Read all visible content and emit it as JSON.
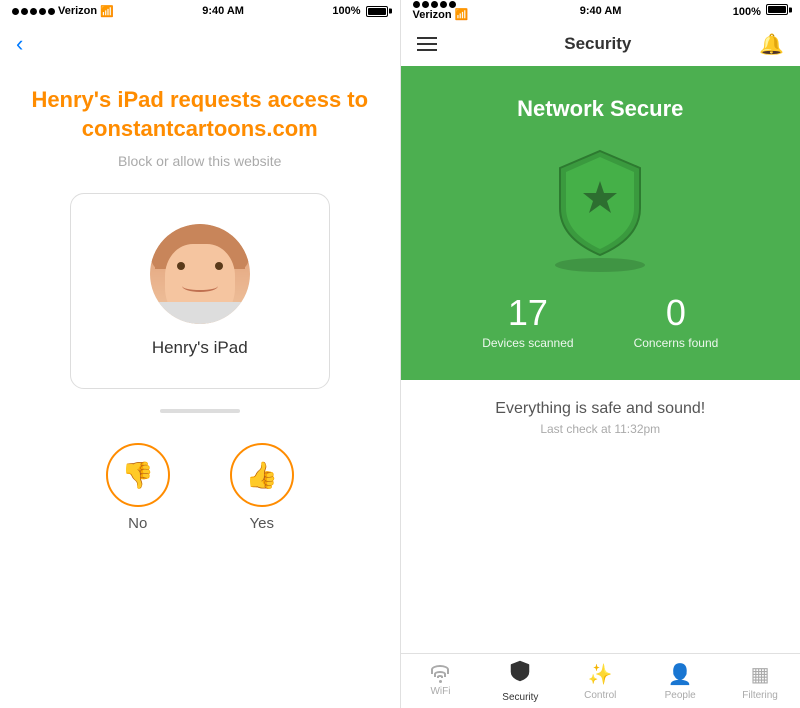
{
  "left": {
    "status_bar": {
      "carrier": "Verizon",
      "time": "9:40 AM",
      "battery": "100%"
    },
    "request_title": "Henry's iPad requests access to constantcartoons.com",
    "request_subtitle": "Block or allow this website",
    "device_name": "Henry's iPad",
    "no_label": "No",
    "yes_label": "Yes"
  },
  "right": {
    "status_bar": {
      "carrier": "Verizon",
      "time": "9:40 AM",
      "battery": "100%"
    },
    "title": "Security",
    "banner": {
      "heading": "Network Secure",
      "devices_scanned_count": "17",
      "devices_scanned_label": "Devices scanned",
      "concerns_found_count": "0",
      "concerns_found_label": "Concerns found"
    },
    "safe_text": "Everything is safe and sound!",
    "last_check": "Last check at 11:32pm",
    "tabs": [
      {
        "id": "wifi",
        "label": "WiFi"
      },
      {
        "id": "security",
        "label": "Security"
      },
      {
        "id": "control",
        "label": "Control"
      },
      {
        "id": "people",
        "label": "People"
      },
      {
        "id": "filtering",
        "label": "Filtering"
      }
    ]
  }
}
